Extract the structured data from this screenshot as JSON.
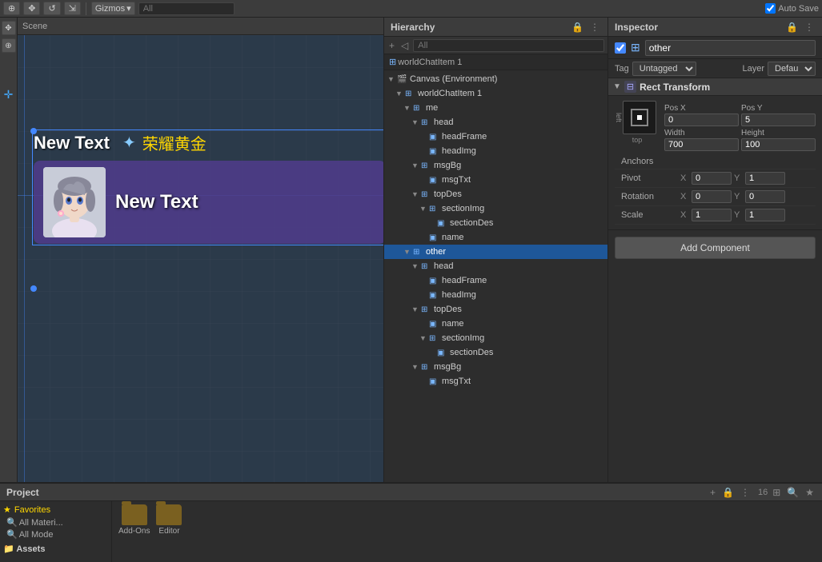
{
  "topToolbar": {
    "gizmos": "Gizmos",
    "allSearch": "All",
    "autoSave": "Auto Save"
  },
  "hierarchy": {
    "title": "Hierarchy",
    "searchPlaceholder": "All",
    "breadcrumb": "worldChatItem 1",
    "items": [
      {
        "id": "canvas",
        "label": "Canvas (Environment)",
        "indent": 0,
        "arrow": "▼",
        "icon": "🎬",
        "selected": false
      },
      {
        "id": "worldChatItem1",
        "label": "worldChatItem 1",
        "indent": 1,
        "arrow": "▼",
        "icon": "⊞",
        "selected": false
      },
      {
        "id": "me",
        "label": "me",
        "indent": 2,
        "arrow": "▼",
        "icon": "⊞",
        "selected": false
      },
      {
        "id": "head",
        "label": "head",
        "indent": 3,
        "arrow": "▼",
        "icon": "⊞",
        "selected": false
      },
      {
        "id": "headFrame",
        "label": "headFrame",
        "indent": 4,
        "arrow": "",
        "icon": "▣",
        "selected": false
      },
      {
        "id": "headImg",
        "label": "headImg",
        "indent": 4,
        "arrow": "",
        "icon": "▣",
        "selected": false
      },
      {
        "id": "msgBg",
        "label": "msgBg",
        "indent": 3,
        "arrow": "▼",
        "icon": "⊞",
        "selected": false
      },
      {
        "id": "msgTxt",
        "label": "msgTxt",
        "indent": 4,
        "arrow": "",
        "icon": "▣",
        "selected": false
      },
      {
        "id": "topDes",
        "label": "topDes",
        "indent": 3,
        "arrow": "▼",
        "icon": "⊞",
        "selected": false
      },
      {
        "id": "sectionImg",
        "label": "sectionImg",
        "indent": 4,
        "arrow": "▼",
        "icon": "⊞",
        "selected": false
      },
      {
        "id": "sectionDes",
        "label": "sectionDes",
        "indent": 5,
        "arrow": "",
        "icon": "▣",
        "selected": false
      },
      {
        "id": "name",
        "label": "name",
        "indent": 4,
        "arrow": "",
        "icon": "▣",
        "selected": false
      },
      {
        "id": "other",
        "label": "other",
        "indent": 2,
        "arrow": "▼",
        "icon": "⊞",
        "selected": true
      },
      {
        "id": "head2",
        "label": "head",
        "indent": 3,
        "arrow": "▼",
        "icon": "⊞",
        "selected": false
      },
      {
        "id": "headFrame2",
        "label": "headFrame",
        "indent": 4,
        "arrow": "",
        "icon": "▣",
        "selected": false
      },
      {
        "id": "headImg2",
        "label": "headImg",
        "indent": 4,
        "arrow": "",
        "icon": "▣",
        "selected": false
      },
      {
        "id": "topDes2",
        "label": "topDes",
        "indent": 3,
        "arrow": "▼",
        "icon": "⊞",
        "selected": false
      },
      {
        "id": "name2",
        "label": "name",
        "indent": 4,
        "arrow": "",
        "icon": "▣",
        "selected": false
      },
      {
        "id": "sectionImg2",
        "label": "sectionImg",
        "indent": 4,
        "arrow": "▼",
        "icon": "⊞",
        "selected": false
      },
      {
        "id": "sectionDes2",
        "label": "sectionDes",
        "indent": 5,
        "arrow": "",
        "icon": "▣",
        "selected": false
      },
      {
        "id": "msgBg2",
        "label": "msgBg",
        "indent": 3,
        "arrow": "▼",
        "icon": "⊞",
        "selected": false
      },
      {
        "id": "msgTxt2",
        "label": "msgTxt",
        "indent": 4,
        "arrow": "",
        "icon": "▣",
        "selected": false
      }
    ]
  },
  "inspector": {
    "title": "Inspector",
    "objectName": "other",
    "tag": "Untagged",
    "layer": "Defau",
    "rectTransform": {
      "title": "Rect Transform",
      "posX": "0",
      "posY": "5",
      "width": "700",
      "height": "100",
      "anchorLabel": "Anchors",
      "pivotLabel": "Pivot",
      "pivotX": "0",
      "pivotY": "1",
      "rotationLabel": "Rotation",
      "rotationX": "0",
      "rotationY": "0",
      "scaleLabel": "Scale",
      "scaleX": "1",
      "scaleY": "1",
      "leftLabel": "left",
      "topLabel": "top"
    },
    "addComponent": "Add Component"
  },
  "scene": {
    "headerText": "New Text",
    "starBadge": "✦",
    "chineseText": "荣耀黄金",
    "chatText": "New Text"
  },
  "project": {
    "title": "Project",
    "searchPlaceholder": "",
    "favoritesLabel": "Favorites",
    "allMaterials": "All Materi...",
    "allMode": "All Mode",
    "assetsLabel": "Assets",
    "addOns": "Add-Ons",
    "editor": "Editor"
  }
}
